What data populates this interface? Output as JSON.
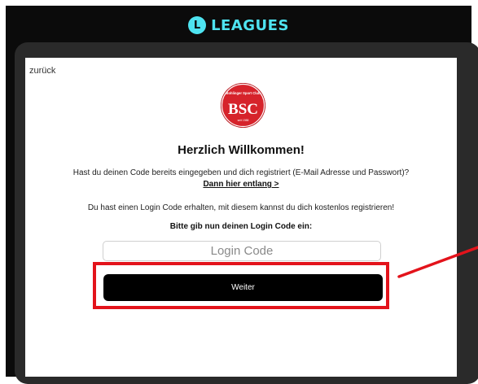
{
  "header": {
    "brand_mark": "L",
    "brand_name": "LEAGUES"
  },
  "card": {
    "back_label": "zurück",
    "club_logo": {
      "top_text": "Bohlinger Sport Club",
      "letters": "BSC",
      "bottom_text": "seit 1988"
    },
    "title": "Herzlich Willkommen!",
    "registered_prompt": "Hast du deinen Code bereits eingegeben und dich registriert (E-Mail Adresse und Passwort)?",
    "registered_link": "Dann hier entlang >",
    "login_info": "Du hast einen Login Code erhalten, mit diesem kannst du dich kostenlos registrieren!",
    "code_prompt": "Bitte gib nun deinen Login Code ein:",
    "code_input": {
      "placeholder": "Login Code",
      "value": ""
    },
    "submit_label": "Weiter"
  },
  "annotation": {
    "highlight_color": "#e3131b"
  },
  "colors": {
    "brand_accent": "#4ee3f0",
    "background": "#0b0b0b",
    "button": "#000000",
    "club_red": "#d6232b"
  }
}
